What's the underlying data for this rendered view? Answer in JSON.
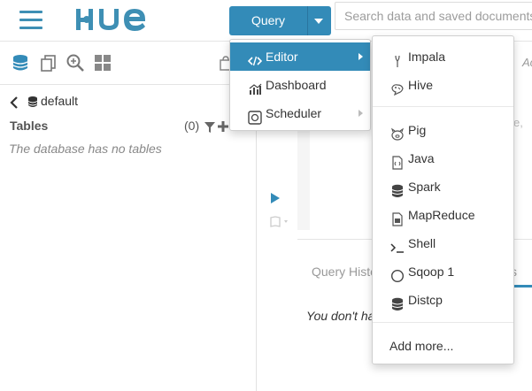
{
  "header": {
    "logo_text": "HUE",
    "query_button_label": "Query",
    "search_placeholder": "Search data and saved documents..."
  },
  "left_panel": {
    "tab_icons": [
      "database-icon",
      "documents-icon",
      "search-data-icon",
      "apps-icon"
    ],
    "database_name": "default",
    "tables_label": "Tables",
    "tables_count": "(0)",
    "empty_message": "The database has no tables"
  },
  "query_menu": {
    "items": [
      {
        "label": "Editor",
        "icon": "code-icon",
        "has_submenu": true,
        "active": true
      },
      {
        "label": "Dashboard",
        "icon": "chart-icon",
        "has_submenu": false,
        "active": false
      },
      {
        "label": "Scheduler",
        "icon": "scheduler-icon",
        "has_submenu": true,
        "active": false
      }
    ]
  },
  "editor_submenu": {
    "group1": [
      {
        "label": "Impala",
        "icon": "impala-icon"
      },
      {
        "label": "Hive",
        "icon": "hive-icon"
      }
    ],
    "group2": [
      {
        "label": "Pig",
        "icon": "pig-icon"
      },
      {
        "label": "Java",
        "icon": "java-file-icon"
      },
      {
        "label": "Spark",
        "icon": "spark-icon"
      },
      {
        "label": "MapReduce",
        "icon": "mapreduce-file-icon"
      },
      {
        "label": "Shell",
        "icon": "terminal-icon"
      },
      {
        "label": "Sqoop 1",
        "icon": "sqoop-circle-icon"
      },
      {
        "label": "Distcp",
        "icon": "distcp-database-icon"
      }
    ],
    "add_more_label": "Add more..."
  },
  "right_panel": {
    "autocomplete_fragment": "Ac",
    "hint_fragment": "e,",
    "history_tab_label": "Query Histo",
    "history_tab2_fragment": "s",
    "no_history_fragment": "You don't ha"
  },
  "colors": {
    "accent": "#338bb8",
    "logo": "#3e8fb4",
    "menu_active_bg": "#338bb8"
  }
}
